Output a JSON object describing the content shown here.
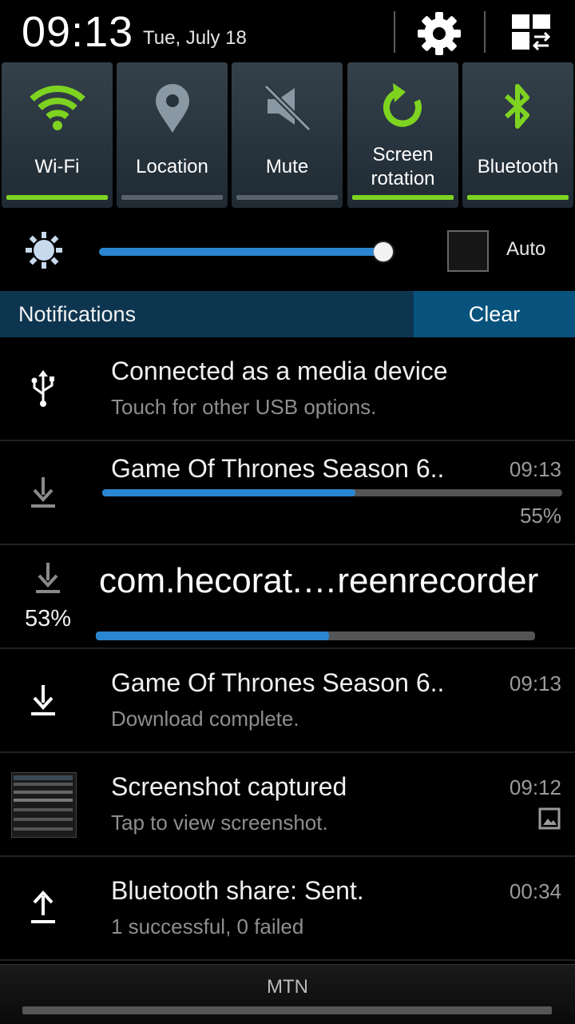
{
  "status": {
    "time": "09:13",
    "date": "Tue, July 18"
  },
  "header_icons": [
    "gear-icon",
    "multi-window-icon"
  ],
  "toggles": [
    {
      "label": "Wi-Fi",
      "state": "on",
      "icon": "wifi-icon"
    },
    {
      "label": "Location",
      "state": "off",
      "icon": "location-icon"
    },
    {
      "label": "Mute",
      "state": "off",
      "icon": "mute-icon"
    },
    {
      "label": "Screen rotation",
      "state": "on",
      "icon": "rotation-icon"
    },
    {
      "label": "Bluetooth",
      "state": "on",
      "icon": "bluetooth-icon"
    }
  ],
  "brightness": {
    "level": 0.99,
    "auto_label": "Auto",
    "auto_checked": false
  },
  "notifications_header": {
    "title": "Notifications",
    "clear_label": "Clear"
  },
  "notifications": [
    {
      "title": "Connected as a media device",
      "subtitle": "Touch for other USB options.",
      "icon": "usb-icon"
    },
    {
      "title": "Game Of Thrones Season 6..",
      "time": "09:13",
      "progress_label": "55%",
      "progress": 0.55,
      "icon": "download-icon"
    },
    {
      "title": "com.hecorat.…reenrecorder",
      "progress_label": "53%",
      "progress": 0.53,
      "icon": "download-icon"
    },
    {
      "title": "Game Of Thrones Season 6..",
      "time": "09:13",
      "subtitle": "Download complete.",
      "icon": "download-complete-icon"
    },
    {
      "title": "Screenshot captured",
      "time": "09:12",
      "subtitle": "Tap to view screenshot.",
      "icon": "screenshot-thumbnail"
    },
    {
      "title": "Bluetooth share: Sent.",
      "time": "00:34",
      "subtitle": "1 successful, 0 failed",
      "icon": "upload-icon"
    }
  ],
  "carrier": "MTN",
  "colors": {
    "accent_on": "#7ed321",
    "progress": "#2a86d0",
    "notif_header": "#0e3550",
    "clear_button": "#08537d"
  }
}
